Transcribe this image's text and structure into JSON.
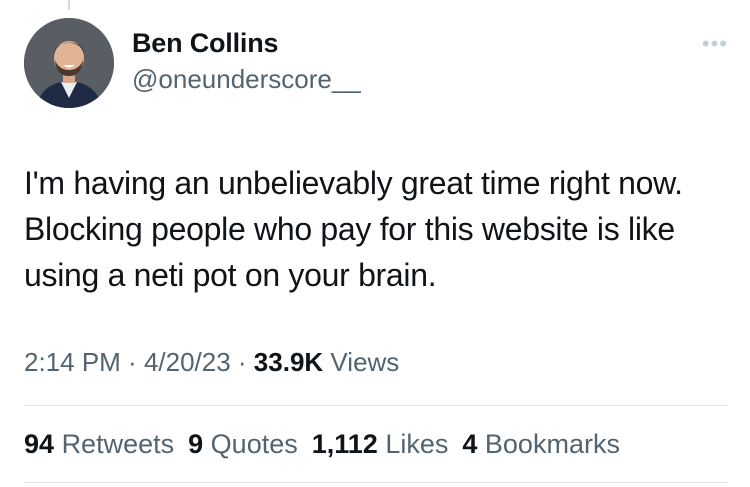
{
  "author": {
    "name": "Ben Collins",
    "handle": "@oneunderscore__"
  },
  "icons": {
    "more": "more-horizontal-icon",
    "avatar": "profile-photo"
  },
  "tweet": {
    "text": "I'm having an unbelievably great time right now. Blocking people who pay for this website is like using a neti pot on your brain."
  },
  "meta": {
    "time": "2:14 PM",
    "sep1": " · ",
    "date": "4/20/23",
    "sep2": " · ",
    "views_count": "33.9K",
    "views_label": "Views"
  },
  "stats": {
    "retweets_count": "94",
    "retweets_label": "Retweets",
    "quotes_count": "9",
    "quotes_label": "Quotes",
    "likes_count": "1,112",
    "likes_label": "Likes",
    "bookmarks_count": "4",
    "bookmarks_label": "Bookmarks"
  },
  "colors": {
    "text": "#0f1419",
    "secondary": "#536471",
    "divider": "#dfe5e8"
  }
}
